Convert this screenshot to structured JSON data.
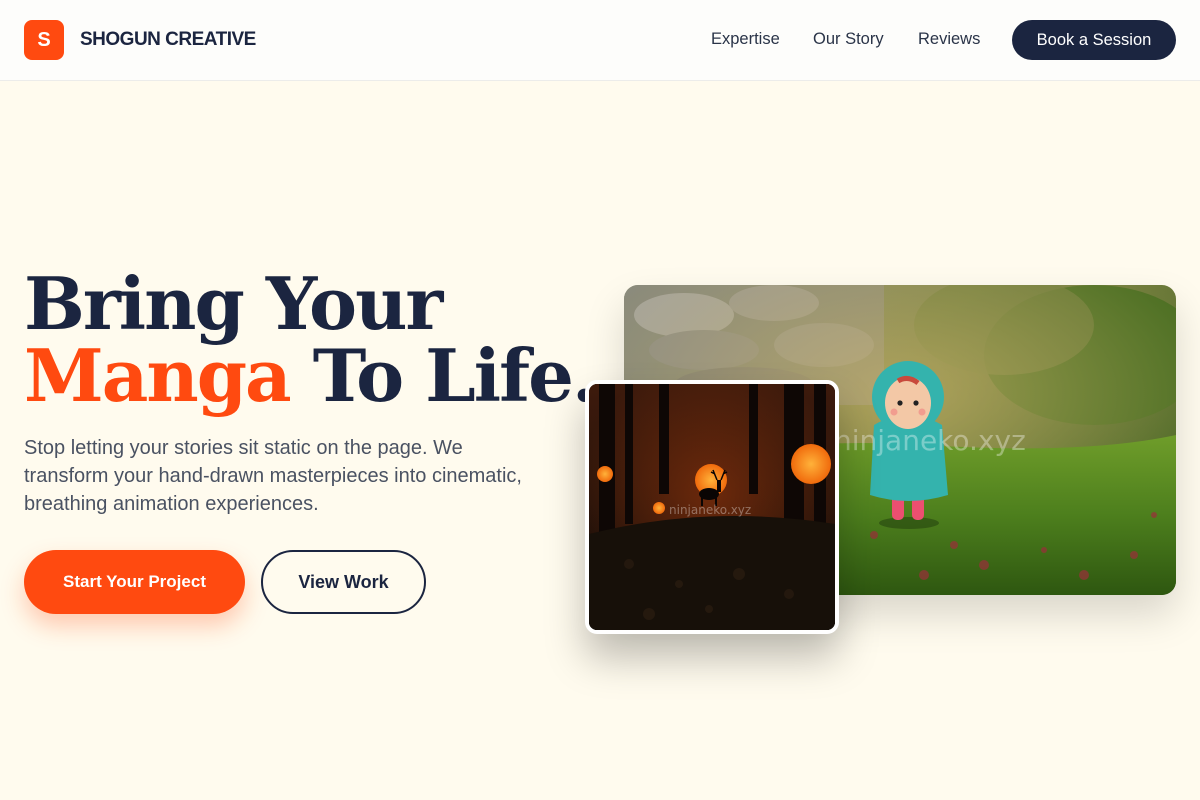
{
  "brand": {
    "badge_letter": "S",
    "name": "SHOGUN CREATIVE",
    "accent_color": "#ff4a10",
    "dark_color": "#1b2540"
  },
  "nav": {
    "items": [
      "Expertise",
      "Our Story",
      "Reviews"
    ],
    "cta": "Book a Session"
  },
  "hero": {
    "title_line1": "Bring Your",
    "title_accent": "Manga",
    "title_line2_rest": " To Life.",
    "subtitle": "Stop letting your stories sit static on the page. We transform your hand-drawn masterpieces into cinematic, breathing animation experiences.",
    "primary_cta": "Start Your Project",
    "secondary_cta": "View Work"
  },
  "images": {
    "main": {
      "subject": "figurine in teal raincoat on grass with stone wall",
      "watermark": "ninjaneko.xyz"
    },
    "small": {
      "subject": "deer silhouette in dark forest with orange sun",
      "watermark": "ninjaneko.xyz"
    }
  }
}
